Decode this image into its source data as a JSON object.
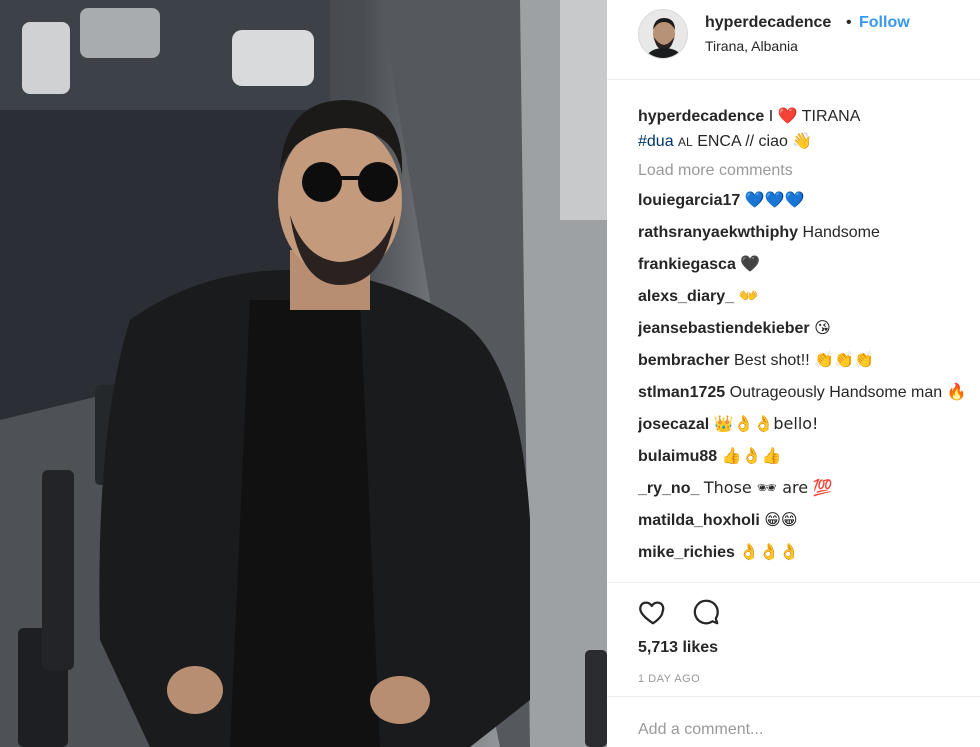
{
  "post": {
    "username": "hyperdecadence",
    "separator": "•",
    "follow_label": "Follow",
    "location": "Tirana, Albania",
    "caption": {
      "username": "hyperdecadence",
      "text_before_heart": "I",
      "heart": "❤️",
      "text_after_heart": "TIRANA",
      "hashtag": "#dua",
      "smallcaps": "AL",
      "line2_rest": "ENCA // ciao",
      "wave": "👋"
    },
    "load_more_label": "Load more comments",
    "comments": [
      {
        "user": "louiegarcia17",
        "text": "",
        "emoji": "💙💙💙"
      },
      {
        "user": "rathsranyaekwthiphy",
        "text": "Handsome",
        "emoji": ""
      },
      {
        "user": "frankiegasca",
        "text": "",
        "emoji": "🖤"
      },
      {
        "user": "alexs_diary_",
        "text": "",
        "emoji": "👐"
      },
      {
        "user": "jeansebastiendekieber",
        "text": "",
        "emoji": "😘"
      },
      {
        "user": "bembracher",
        "text": "Best shot!!",
        "emoji": "👏👏👏"
      },
      {
        "user": "stlman1725",
        "text": "Outrageously Handsome man",
        "emoji": "🔥"
      },
      {
        "user": "josecazal",
        "text": "👑👌👌bello!",
        "emoji": ""
      },
      {
        "user": "bulaimu88",
        "text": "",
        "emoji": "👍👌👍"
      },
      {
        "user": "_ry_no_",
        "text": "Those 🕶 are",
        "emoji": "💯"
      },
      {
        "user": "matilda_hoxholi",
        "text": "",
        "emoji": "😁😁"
      },
      {
        "user": "mike_richies",
        "text": "",
        "emoji": "👌👌👌"
      }
    ],
    "icons": {
      "like": "heart-outline-icon",
      "comment": "comment-bubble-icon"
    },
    "likes": "5,713 likes",
    "timestamp": "1 DAY AGO",
    "add_comment_placeholder": "Add a comment..."
  }
}
